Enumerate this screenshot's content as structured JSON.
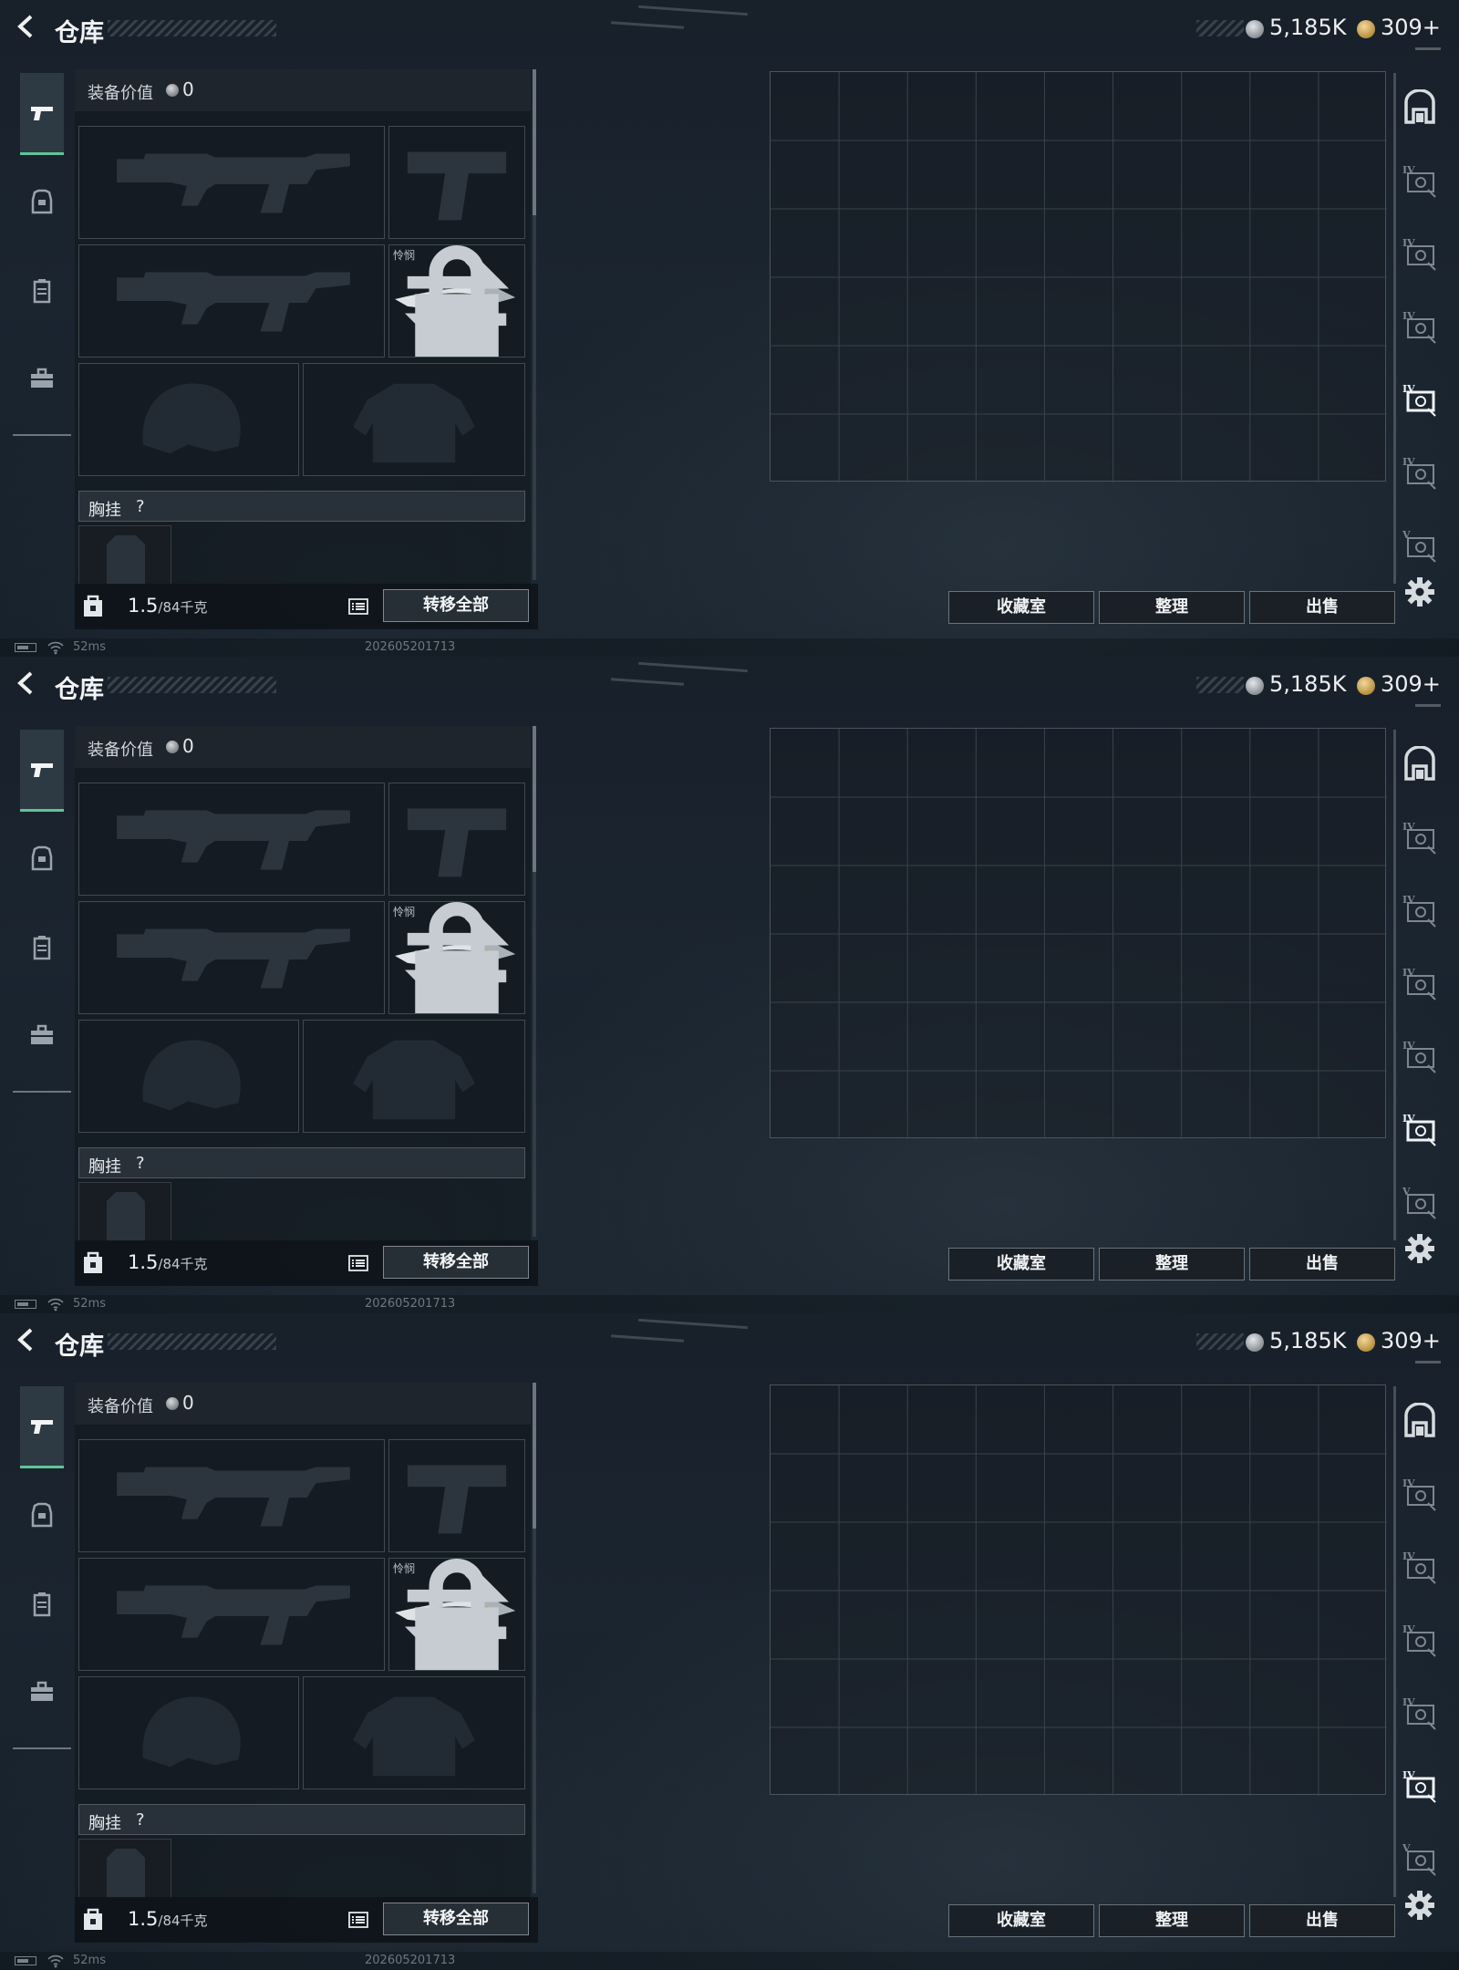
{
  "header": {
    "title": "仓库"
  },
  "currency": {
    "silver": "5,185K",
    "gold": "309+"
  },
  "nav": {
    "items": [
      {
        "name": "weapons",
        "icon": "pistol-icon",
        "active": true
      },
      {
        "name": "gear",
        "icon": "armor-icon",
        "active": false
      },
      {
        "name": "supplies",
        "icon": "canister-icon",
        "active": false
      },
      {
        "name": "toolbox",
        "icon": "toolbox-icon",
        "active": false
      }
    ]
  },
  "loadout": {
    "value_label": "装备价值",
    "value": "0",
    "knife_name": "怜悯",
    "chest_rig_label": "胸挂",
    "chest_rig_hint": "?"
  },
  "footer": {
    "weight_current": "1.5",
    "weight_capacity": "/84千克",
    "transfer_label": "转移全部"
  },
  "storage": {
    "columns": 9,
    "rows": 6,
    "buttons": {
      "collection": "收藏室",
      "sort": "整理",
      "sell": "出售"
    },
    "rail": [
      {
        "icon": "home-vault-icon"
      },
      {
        "icon": "container-iv-icon",
        "label": "IV"
      },
      {
        "icon": "container-iv-icon",
        "label": "IV"
      },
      {
        "icon": "container-iv-icon",
        "label": "IV"
      },
      {
        "icon": "container-iv-icon",
        "label": "IV"
      },
      {
        "icon": "container-iv-icon",
        "label": "IV"
      },
      {
        "icon": "container-v-icon",
        "label": "V"
      }
    ]
  },
  "status": {
    "ping": "52ms",
    "build": "202605201713"
  },
  "screens": [
    {
      "selected_rail": 4
    },
    {
      "selected_rail": 5
    },
    {
      "selected_rail": 5
    }
  ]
}
